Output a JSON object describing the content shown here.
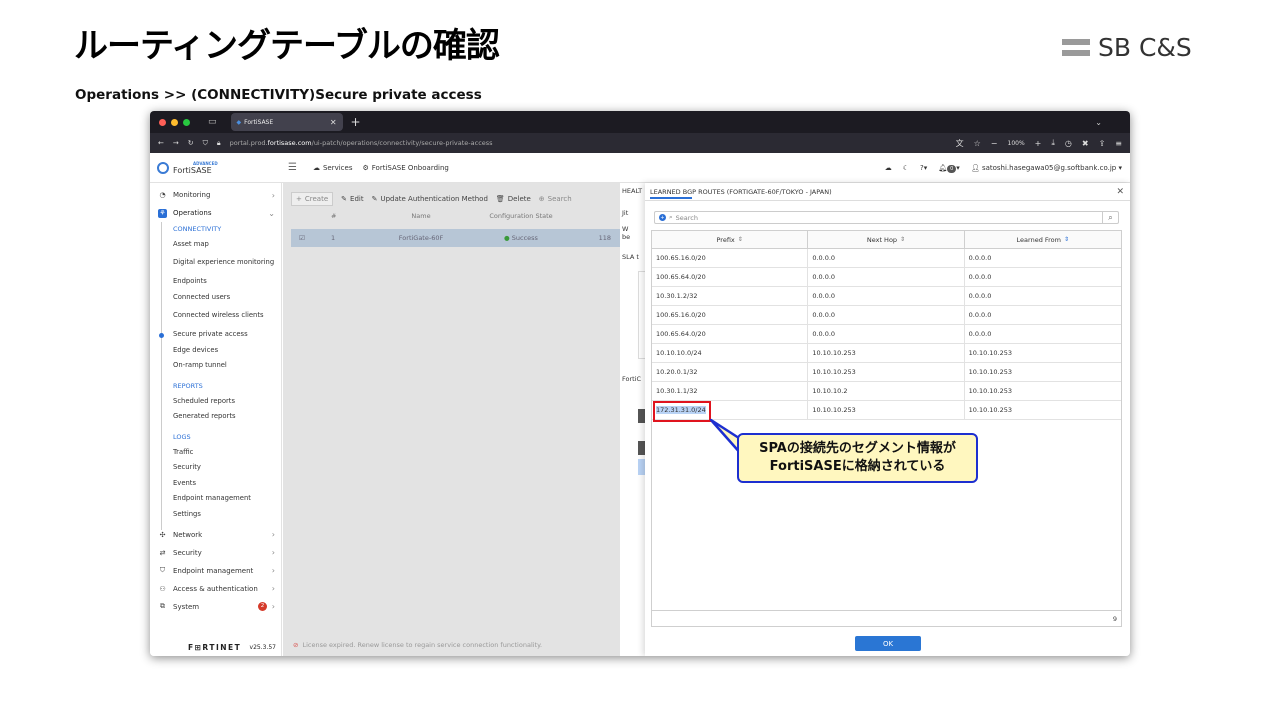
{
  "slide": {
    "title": "ルーティングテーブルの確認",
    "breadcrumb": "Operations >> (CONNECTIVITY)Secure private access",
    "logo": "SB C&S"
  },
  "browser": {
    "tab_label": "FortiSASE",
    "url_prefix": "portal.prod.",
    "url_domain": "fortisase.com",
    "url_suffix": "/ui-patch/operations/connectivity/secure-private-access",
    "zoom": "100%"
  },
  "app": {
    "brand_small": "ADVANCED",
    "brand": "FortiSASE",
    "services": "Services",
    "onboarding": "FortiSASE Onboarding",
    "notif_count": "0",
    "user": "satoshi.hasegawa05@g.softbank.co.jp"
  },
  "sidebar": {
    "monitoring": "Monitoring",
    "operations": "Operations",
    "connectivity_head": "CONNECTIVITY",
    "connectivity": [
      "Asset map",
      "Digital experience monitoring",
      "Endpoints",
      "Connected users",
      "Connected wireless clients",
      "Secure private access",
      "Edge devices",
      "On-ramp tunnel"
    ],
    "reports_head": "REPORTS",
    "reports": [
      "Scheduled reports",
      "Generated reports"
    ],
    "logs_head": "LOGS",
    "logs": [
      "Traffic",
      "Security",
      "Events",
      "Endpoint management",
      "Settings"
    ],
    "network": "Network",
    "security": "Security",
    "endpoint_mgmt": "Endpoint management",
    "access_auth": "Access & authentication",
    "system": "System",
    "system_badge": "2",
    "footer_logo": "F⊞RTINET",
    "version": "v25.3.57"
  },
  "main": {
    "toolbar": {
      "create": "Create",
      "edit": "Edit",
      "update_auth": "Update Authentication Method",
      "delete": "Delete",
      "search": "Search"
    },
    "grid_headers": [
      "#",
      "Name",
      "Configuration State"
    ],
    "row": {
      "num": "1",
      "name": "FortiGate-60F",
      "state": "Success",
      "extra": "118"
    },
    "status": "License expired. Renew license to regain service connection functionality."
  },
  "side_panel": {
    "tab": "HEALT",
    "frag1": "Jit",
    "frag2": "W",
    "frag3": "be",
    "sla": "SLA t",
    "forti": "FortiC"
  },
  "dialog": {
    "title": "LEARNED BGP ROUTES (FORTIGATE-60F/TOKYO - JAPAN)",
    "search_placeholder": "Search",
    "headers": [
      "Prefix",
      "Next Hop",
      "Learned From"
    ],
    "rows": [
      [
        "100.65.16.0/20",
        "0.0.0.0",
        "0.0.0.0"
      ],
      [
        "100.65.64.0/20",
        "0.0.0.0",
        "0.0.0.0"
      ],
      [
        "10.30.1.2/32",
        "0.0.0.0",
        "0.0.0.0"
      ],
      [
        "100.65.16.0/20",
        "0.0.0.0",
        "0.0.0.0"
      ],
      [
        "100.65.64.0/20",
        "0.0.0.0",
        "0.0.0.0"
      ],
      [
        "10.10.10.0/24",
        "10.10.10.253",
        "10.10.10.253"
      ],
      [
        "10.20.0.1/32",
        "10.10.10.253",
        "10.10.10.253"
      ],
      [
        "10.30.1.1/32",
        "10.10.10.2",
        "10.10.10.253"
      ],
      [
        "172.31.31.0/24",
        "10.10.10.253",
        "10.10.10.253"
      ]
    ],
    "count": "9",
    "ok": "OK"
  },
  "callout": {
    "line1": "SPAの接続先のセグメント情報が",
    "line2": "FortiSASEに格納されている",
    "border_color": "#1d2fd0",
    "fill_color": "#fff7bf"
  }
}
